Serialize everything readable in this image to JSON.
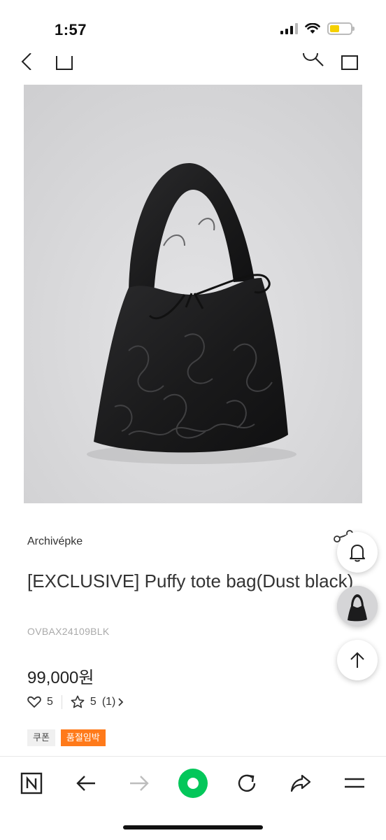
{
  "status_bar": {
    "time": "1:57",
    "battery_level": 0.45
  },
  "product": {
    "brand": "Archivépke",
    "title": "[EXCLUSIVE] Puffy tote bag(Dust black)",
    "sku": "OVBAX24109BLK",
    "price": "99,000원",
    "likes_count": "5",
    "rating": "5",
    "review_count": "(1)",
    "tags": {
      "coupon": "쿠폰",
      "sold_out_soon": "품절임박"
    }
  },
  "icons": {
    "back": "chevron-left-icon",
    "home": "home-icon",
    "search": "search-icon",
    "cart": "bag-icon",
    "share": "share-icon",
    "bell": "bell-icon",
    "scroll_top": "arrow-up-icon",
    "heart": "heart-icon",
    "star": "star-icon"
  },
  "colors": {
    "soldout_tag": "#ff7a1a",
    "browser_accent": "#03c75a",
    "battery": "#f5d000"
  }
}
